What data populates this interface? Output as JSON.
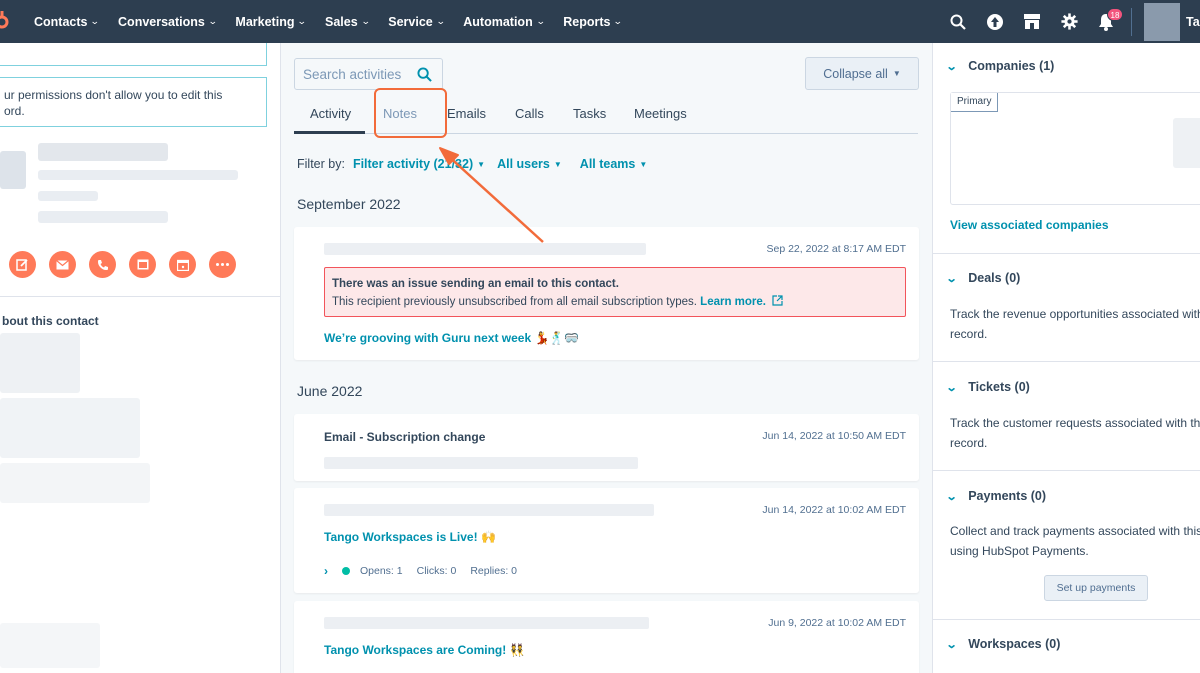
{
  "nav": {
    "items": [
      {
        "label": "Contacts"
      },
      {
        "label": "Conversations"
      },
      {
        "label": "Marketing"
      },
      {
        "label": "Sales"
      },
      {
        "label": "Service"
      },
      {
        "label": "Automation"
      },
      {
        "label": "Reports"
      }
    ],
    "notification_count": "18",
    "user_initial": "Ta",
    "icons": [
      "search-icon",
      "upgrade-icon",
      "marketplace-icon",
      "settings-icon",
      "notifications-icon"
    ]
  },
  "left": {
    "permission_text_line1": "ur permissions don't allow you to edit this",
    "permission_text_line2": "ord.",
    "about_title": "bout this contact",
    "actions": [
      "note-icon",
      "email-icon",
      "call-icon",
      "task-icon",
      "meeting-icon",
      "more-icon"
    ]
  },
  "main": {
    "search_placeholder": "Search activities",
    "collapse_label": "Collapse all",
    "tabs": [
      {
        "label": "Activity"
      },
      {
        "label": "Notes"
      },
      {
        "label": "Emails"
      },
      {
        "label": "Calls"
      },
      {
        "label": "Tasks"
      },
      {
        "label": "Meetings"
      }
    ],
    "filter": {
      "label": "Filter by:",
      "activity": "Filter activity (21/32)",
      "users": "All users",
      "teams": "All teams"
    },
    "groups": [
      {
        "month": "September 2022"
      },
      {
        "month": "June 2022"
      }
    ],
    "cards": [
      {
        "time": "Sep 22, 2022 at 8:17 AM EDT",
        "alert_title": "There was an issue sending an email to this contact.",
        "alert_body": "This recipient previously unsubscribed from all email subscription types.",
        "alert_link": "Learn more.",
        "link": "We’re grooving with Guru next week 💃🕺🥽"
      },
      {
        "title": "Email - Subscription change",
        "time": "Jun 14, 2022 at 10:50 AM EDT"
      },
      {
        "time": "Jun 14, 2022 at 10:02 AM EDT",
        "link": "Tango Workspaces is Live! 🙌",
        "opens": "Opens: 1",
        "clicks": "Clicks: 0",
        "replies": "Replies: 0"
      },
      {
        "time": "Jun 9, 2022 at 10:02 AM EDT",
        "link": "Tango Workspaces are Coming! 👯"
      }
    ]
  },
  "right": {
    "companies": {
      "title": "Companies (1)",
      "primary": "Primary",
      "link": "View associated companies"
    },
    "deals": {
      "title": "Deals (0)",
      "text1": "Track the revenue opportunities associated with",
      "text2": "record."
    },
    "tickets": {
      "title": "Tickets (0)",
      "text1": "Track the customer requests associated with thi",
      "text2": "record."
    },
    "payments": {
      "title": "Payments (0)",
      "text1": "Collect and track payments associated with this",
      "text2": "using HubSpot Payments.",
      "button": "Set up payments"
    },
    "workspaces": {
      "title": "Workspaces (0)"
    }
  },
  "colors": {
    "nav_bg": "#2d3e50",
    "accent": "#0091ae",
    "action_orange": "#ff7a59",
    "highlight": "#f26b3a",
    "alert_bg": "#fde8e9"
  }
}
